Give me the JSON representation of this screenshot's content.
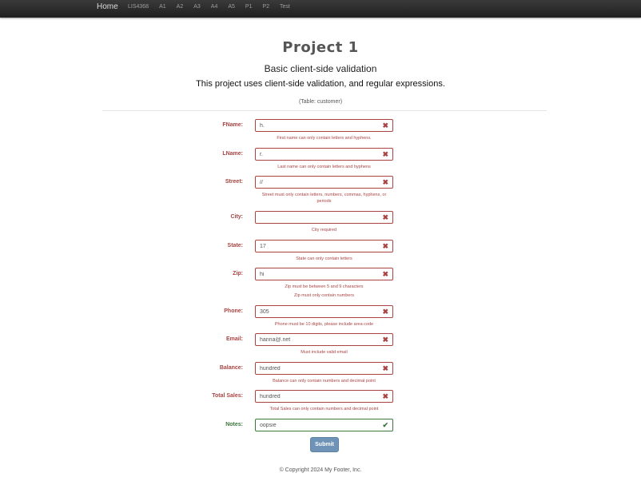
{
  "nav": {
    "brand": "Home",
    "links": [
      "LIS4368",
      "A1",
      "A2",
      "A3",
      "A4",
      "A5",
      "P1",
      "P2",
      "Test"
    ]
  },
  "header": {
    "title": "Project 1",
    "subtitle": "Basic client-side validation",
    "description": "This project uses client-side validation, and regular expressions.",
    "table_note": "(Table: customer)"
  },
  "form": {
    "fields": [
      {
        "label": "FName:",
        "value": "h.",
        "status": "error",
        "help": [
          "First name can only contain letters and hyphens."
        ]
      },
      {
        "label": "LName:",
        "value": "r.",
        "status": "error",
        "help": [
          "Last name can only contain letters and hyphens"
        ]
      },
      {
        "label": "Street:",
        "value": "//",
        "status": "error",
        "help": [
          "Street must only contain letters, numbers, commas, hyphens, or",
          "periods"
        ]
      },
      {
        "label": "City:",
        "value": "",
        "status": "error",
        "help": [
          "City required"
        ]
      },
      {
        "label": "State:",
        "value": "17",
        "status": "error",
        "help": [
          "State can only contain letters"
        ]
      },
      {
        "label": "Zip:",
        "value": "hi",
        "status": "error",
        "help": [
          "Zip must be between 5 and 9 characters",
          "Zip must only contain numbers"
        ]
      },
      {
        "label": "Phone:",
        "value": "305",
        "status": "error",
        "help": [
          "Phone must be 10 digits, please include area code"
        ]
      },
      {
        "label": "Email:",
        "value": "hanna@.net",
        "status": "error",
        "help": [
          "Must include valid email"
        ]
      },
      {
        "label": "Balance:",
        "value": "hundred",
        "status": "error",
        "help": [
          "Balance can only contain numbers and decimal point"
        ]
      },
      {
        "label": "Total Sales:",
        "value": "hundred",
        "status": "error",
        "help": [
          "Total Sales can only contain numbers and decimal point"
        ]
      },
      {
        "label": "Notes:",
        "value": "oopsie",
        "status": "ok",
        "help": []
      }
    ],
    "submit_label": "Submit"
  },
  "footer": {
    "text": "© Copyright 2024 My Footer, Inc."
  },
  "colors": {
    "error": "#a94442",
    "success": "#3c763d",
    "submit_bg": "#6f93b7",
    "navbar": "#222222"
  },
  "icons": {
    "error": "times-icon",
    "ok": "check-icon"
  }
}
